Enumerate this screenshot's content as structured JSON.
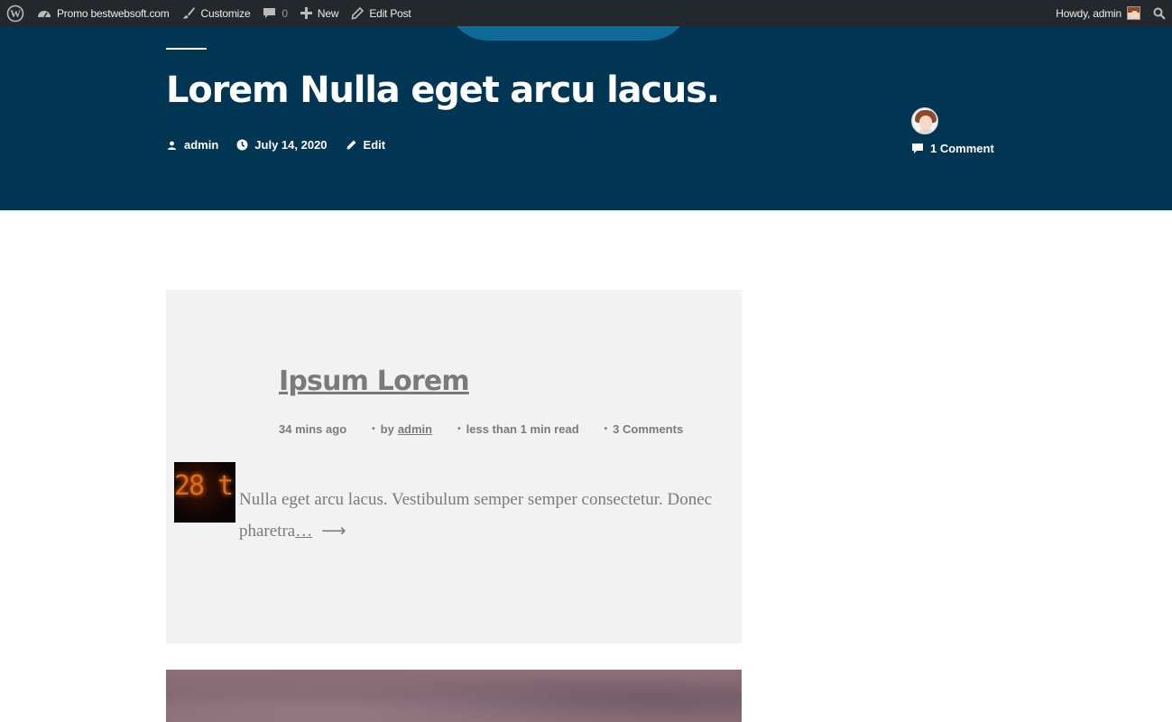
{
  "adminbar": {
    "site_name": "Promo bestwebsoft.com",
    "customize_label": "Customize",
    "comments_count": "0",
    "new_label": "New",
    "edit_post_label": "Edit Post",
    "howdy_label": "Howdy, admin"
  },
  "hero": {
    "title": "Lorem Nulla eget arcu lacus.",
    "author": "admin",
    "date": "July 14, 2020",
    "edit_label": "Edit",
    "comments_label": "1 Comment"
  },
  "card": {
    "title": "Ipsum Lorem",
    "time_ago": "34 mins ago",
    "by_prefix": "by",
    "author": "admin",
    "read_time": "less than 1 min read",
    "comments": "3 Comments",
    "excerpt": "Nulla eget arcu lacus. Vestibulum semper semper consectetur. Donec pharetra",
    "ellipsis": "…",
    "arrow": "⟶",
    "thumb_text": "28 t"
  },
  "colors": {
    "adminbar_bg": "#23282d",
    "hero_bg": "#003553",
    "card_bg": "#f2f2f2",
    "muted_text": "#7a7a7a"
  }
}
